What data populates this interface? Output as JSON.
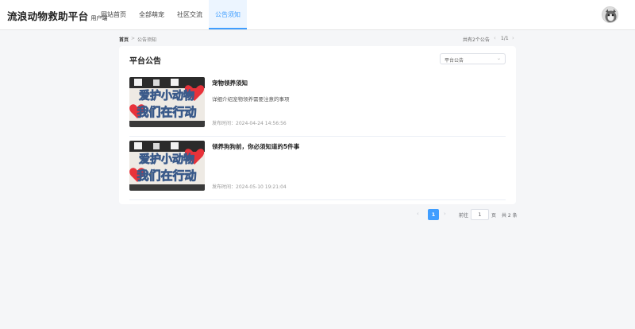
{
  "header": {
    "brand_title": "流浪动物救助平台",
    "brand_sub": "用户端",
    "nav": [
      {
        "label": "网站首页",
        "active": false
      },
      {
        "label": "全部萌宠",
        "active": false
      },
      {
        "label": "社区交流",
        "active": false
      },
      {
        "label": "公告须知",
        "active": true
      }
    ]
  },
  "breadcrumb": {
    "home": "首页",
    "separator": ">",
    "current": "公告须知"
  },
  "summary": {
    "total_text": "共有2个公告",
    "prev": "‹",
    "page_count": "1/1",
    "next": "›"
  },
  "notices": {
    "title": "平台公告",
    "filter": {
      "selected": "平台公告",
      "arrow": "⌄"
    },
    "items": [
      {
        "title": "宠物领养须知",
        "desc": "详细介绍宠物领养需要注意的事项",
        "time": "发布时间：2024-04-24 14:56:56",
        "image_text_top": "爱护小动物",
        "image_text_bottom": "我们在行动"
      },
      {
        "title": "领养狗狗前，你必须知道的5件事",
        "desc": "",
        "time": "发布时间：2024-05-10 19:21:04",
        "image_text_top": "爱护小动物",
        "image_text_bottom": "我们在行动"
      }
    ]
  },
  "pagination": {
    "prev": "‹",
    "current_page": "1",
    "next": "›",
    "goto_label": "前往",
    "goto_value": "1",
    "unit_label": "页",
    "total_label": "共 2 条"
  },
  "colors": {
    "accent": "#409eff",
    "background": "#f5f6f8",
    "card": "#ffffff"
  }
}
